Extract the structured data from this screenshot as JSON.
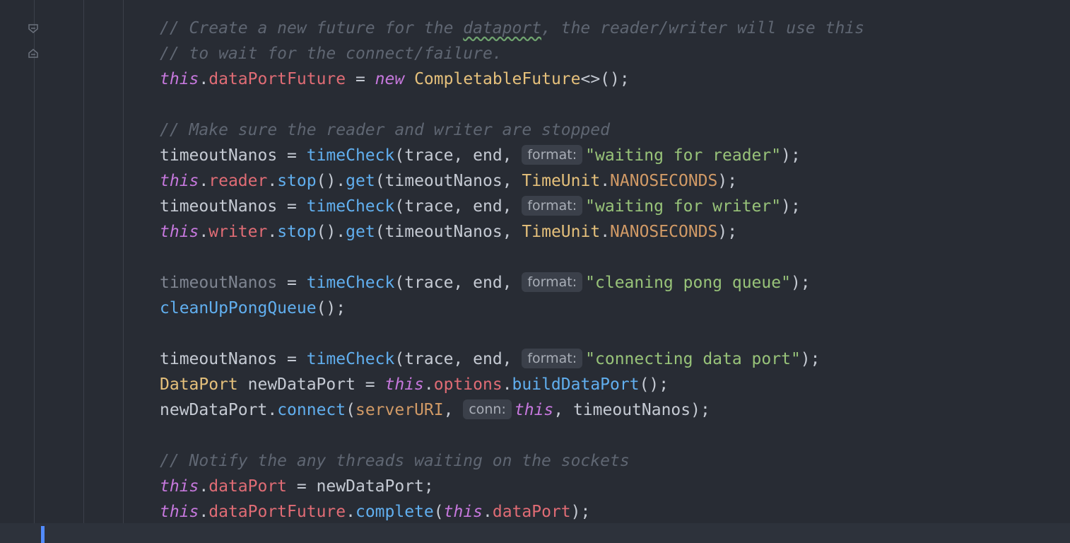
{
  "editor": {
    "comments": {
      "c1": "// Create a new future for the ",
      "c1_word": "dataport",
      "c1_end": ", the reader/writer will use this",
      "c2": "// to wait for the connect/failure.",
      "c3": "// Make sure the reader and writer are stopped",
      "c4": "// Notify the any threads waiting on the sockets"
    },
    "tokens": {
      "this": "this",
      "dot": ".",
      "dataPortFuture": "dataPortFuture",
      "assign": " = ",
      "new": "new",
      "completableFuture": "CompletableFuture",
      "diamond_call": "<>();",
      "timeoutNanos": "timeoutNanos",
      "timeCheck": "timeCheck",
      "trace_end": "(trace, end, ",
      "format_hint": "format:",
      "str_reader": "\"waiting for reader\"",
      "str_writer": "\"waiting for writer\"",
      "str_pong": "\"cleaning pong queue\"",
      "str_data": "\"connecting data port\"",
      "close_semi": ");",
      "reader": "reader",
      "writer": "writer",
      "stop": "stop",
      "call_dot": "().",
      "get": "get",
      "open_timeout": "(timeoutNanos, ",
      "timeUnit": "TimeUnit",
      "nanoseconds": "NANOSECONDS",
      "cleanUpPongQueue": "cleanUpPongQueue",
      "empty_call": "();",
      "dataPortType": "DataPort",
      "newDataPortDecl": " newDataPort = ",
      "options": "options",
      "buildDataPort": "buildDataPort",
      "newDataPort": "newDataPort",
      "connect": "connect",
      "open_paren": "(",
      "serverURI": "serverURI",
      "comma": ", ",
      "conn_hint": "conn:",
      "tail_timeout": ", timeoutNanos);",
      "dataPort": "dataPort",
      "assign_newDataPort": " = newDataPort;",
      "complete": "complete",
      "close_paren_semi": ");"
    }
  }
}
